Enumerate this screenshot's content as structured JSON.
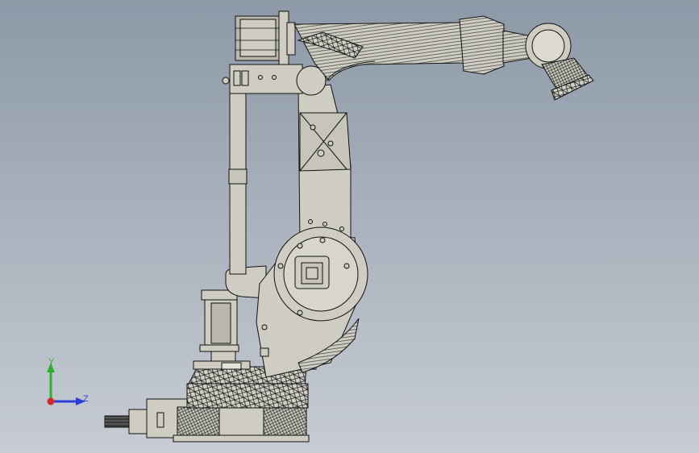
{
  "viewport": {
    "background_top": "#8d99a8",
    "background_bottom": "#c7ccd3"
  },
  "model": {
    "render_mode": "shaded-with-edges",
    "body_color": "#cfcdc2",
    "edge_color": "#1a1a1a",
    "shadow_color": "#9d9b91"
  },
  "triad": {
    "y_label": "Y",
    "z_label": "Z",
    "y_color": "#2fae2f",
    "z_color": "#2a3fd6",
    "x_color": "#d62a2a"
  }
}
